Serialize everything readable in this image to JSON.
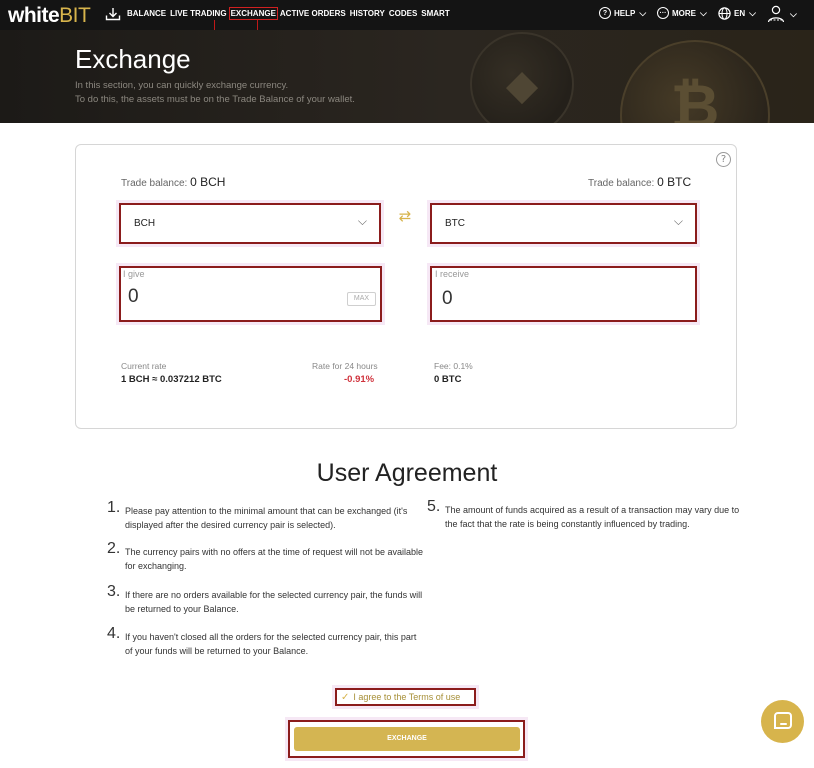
{
  "header": {
    "logo_white": "white",
    "logo_bit": "BIT",
    "nav": [
      "BALANCE",
      "LIVE TRADING",
      "EXCHANGE",
      "ACTIVE ORDERS",
      "HISTORY",
      "CODES",
      "SMART"
    ],
    "active_nav": "EXCHANGE",
    "help": "HELP",
    "more": "MORE",
    "lang": "EN"
  },
  "hero": {
    "title": "Exchange",
    "line1": "In this section, you can quickly exchange currency.",
    "line2": "To do this, the assets must be on the Trade Balance of your wallet."
  },
  "exchange": {
    "balance_label": "Trade balance:",
    "give_balance": "0 BCH",
    "receive_balance": "0 BTC",
    "give_currency": "BCH",
    "receive_currency": "BTC",
    "give_label": "I give",
    "give_value": "0",
    "max_label": "MAX",
    "receive_label": "I receive",
    "receive_value": "0",
    "rate_label": "Current rate",
    "rate_value": "1 BCH ≈ 0.037212 BTC",
    "change_label": "Rate for 24 hours",
    "change_value": "-0.91%",
    "fee_label": "Fee: 0.1%",
    "fee_value": "0 BTC"
  },
  "agreement": {
    "title": "User Agreement",
    "rules": [
      {
        "n": "1.",
        "text": "Please pay attention to the minimal amount that can be exchanged (it's displayed after the desired currency pair is selected)."
      },
      {
        "n": "2.",
        "text": "The currency pairs with no offers at the time of request will not be available for exchanging."
      },
      {
        "n": "3.",
        "text": "If there are no orders available for the selected currency pair, the funds will be returned to your Balance."
      },
      {
        "n": "4.",
        "text": "If you haven't closed all the orders for the selected currency pair, this part of your funds will be returned to your Balance."
      },
      {
        "n": "5.",
        "text": "The amount of funds acquired as a result of a transaction may vary due to the fact that the rate is being constantly influenced by trading."
      }
    ],
    "terms": "I agree to the Terms of use",
    "submit": "EXCHANGE"
  },
  "colors": {
    "accent": "#d7b44c",
    "negative": "#d0323c",
    "highlight_border": "#8b1c1c"
  }
}
